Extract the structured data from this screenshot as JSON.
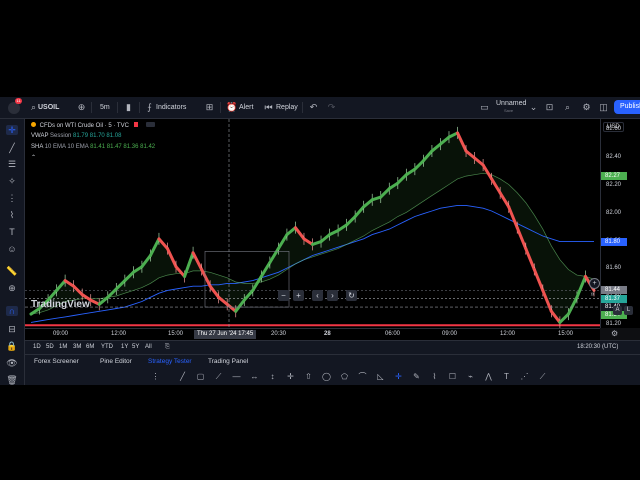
{
  "header": {
    "notification_count": "11",
    "symbol": "USOIL",
    "interval": "5m",
    "indicators_label": "Indicators",
    "alert_label": "Alert",
    "replay_label": "Replay",
    "layout_name": "Unnamed",
    "layout_status": "Save",
    "publish_label": "Publish"
  },
  "legend": {
    "title": "CFDs on WTI Crude Oil · 5 · TVC",
    "vwap_name": "VWAP",
    "vwap_setting": "Session",
    "vwap_values": "81.79  81.70  81.08",
    "sha_name": "SHA",
    "sha_settings": "10  EMA  10  EMA",
    "sha_values": "81.41  81.47  81.36  81.42"
  },
  "watermark": "TradingView",
  "price_axis": {
    "currency": "USD",
    "labels": [
      "82.60",
      "82.40",
      "82.20",
      "82.00",
      "81.80",
      "81.60",
      "81.40",
      "81.20"
    ],
    "badges": [
      {
        "text": "82.27",
        "color": "#4caf50",
        "price": 82.27
      },
      {
        "text": "81.80",
        "color": "#2962ff",
        "price": 81.8
      },
      {
        "text": "81.44",
        "color": "#787b86",
        "price": 81.45
      },
      {
        "text": "81.37",
        "color": "#26a69a",
        "price": 81.39
      },
      {
        "text": "81.40",
        "color": "#131722",
        "price": 81.33
      },
      {
        "text": "81.34",
        "color": "#4caf50",
        "price": 81.27
      }
    ]
  },
  "time_axis": {
    "labels": [
      "09:00",
      "12:00",
      "15:00",
      "20:30",
      "28",
      "06:00",
      "09:00",
      "12:00",
      "15:00"
    ],
    "crosshair_time": "Thu 27 Jun '24   17:45"
  },
  "range_buttons": [
    "1D",
    "5D",
    "1M",
    "3M",
    "6M",
    "YTD",
    "1Y",
    "5Y",
    "All"
  ],
  "clock": "18:20:30 (UTC)",
  "bottom_tabs": [
    "Forex Screener",
    "Pine Editor",
    "Strategy Tester",
    "Trading Panel"
  ],
  "active_bottom_tab": "Strategy Tester",
  "chart_data": {
    "type": "line",
    "title": "CFDs on WTI Crude Oil · 5 · TVC",
    "ylim": [
      81.18,
      82.68
    ],
    "price_series": {
      "name": "USOIL",
      "values": [
        81.28,
        81.32,
        81.38,
        81.45,
        81.52,
        81.48,
        81.42,
        81.38,
        81.35,
        81.4,
        81.46,
        81.52,
        81.58,
        81.62,
        81.7,
        81.82,
        81.75,
        81.62,
        81.55,
        81.72,
        81.6,
        81.48,
        81.4,
        81.35,
        81.3,
        81.38,
        81.45,
        81.55,
        81.65,
        81.75,
        81.85,
        81.9,
        81.82,
        81.78,
        81.8,
        81.85,
        81.88,
        81.92,
        81.98,
        82.05,
        82.1,
        82.12,
        82.18,
        82.22,
        82.28,
        82.32,
        82.38,
        82.45,
        82.5,
        82.55,
        82.58,
        82.45,
        82.4,
        82.35,
        82.25,
        82.15,
        82.05,
        81.9,
        81.75,
        81.6,
        81.45,
        81.3,
        81.22,
        81.28,
        81.4,
        81.55,
        81.45
      ]
    },
    "ema_series": {
      "name": "EMA",
      "values": [
        81.28,
        81.29,
        81.31,
        81.34,
        81.37,
        81.38,
        81.39,
        81.39,
        81.39,
        81.4,
        81.41,
        81.43,
        81.45,
        81.47,
        81.5,
        81.54,
        81.56,
        81.57,
        81.57,
        81.59,
        81.59,
        81.58,
        81.56,
        81.54,
        81.51,
        81.5,
        81.5,
        81.51,
        81.53,
        81.56,
        81.6,
        81.64,
        81.67,
        81.69,
        81.71,
        81.73,
        81.75,
        81.78,
        81.81,
        81.84,
        81.88,
        81.91,
        81.94,
        81.98,
        82.01,
        82.05,
        82.09,
        82.13,
        82.17,
        82.21,
        82.25,
        82.27,
        82.28,
        82.29,
        82.28,
        82.25,
        82.21,
        82.15,
        82.08,
        81.99,
        81.89,
        81.77,
        81.67,
        81.6,
        81.56,
        81.55,
        81.53
      ]
    },
    "vwap_series": {
      "name": "VWAP",
      "values": [
        81.22,
        81.23,
        81.24,
        81.25,
        81.26,
        81.27,
        81.28,
        81.29,
        81.3,
        81.31,
        81.32,
        81.33,
        81.35,
        81.37,
        81.4,
        81.43,
        81.45,
        81.46,
        81.47,
        81.48,
        81.48,
        81.49,
        81.49,
        81.5,
        81.5,
        81.51,
        81.52,
        81.54,
        81.56,
        81.58,
        81.61,
        81.64,
        81.67,
        81.7,
        81.72,
        81.74,
        81.76,
        81.78,
        81.8,
        81.82,
        81.85,
        81.87,
        81.89,
        81.92,
        81.95,
        81.98,
        82.0,
        82.02,
        82.04,
        82.05,
        82.06,
        82.06,
        82.05,
        82.04,
        82.02,
        81.99,
        81.96,
        81.93,
        81.9,
        81.87,
        81.84,
        81.82,
        81.8,
        81.8,
        81.8,
        81.8,
        81.8
      ]
    },
    "horizontal_lines": [
      {
        "price": 81.2,
        "color": "#f23645"
      },
      {
        "price": 81.45,
        "color": "#787b86"
      },
      {
        "price": 81.39,
        "color": "#d1d4dc"
      }
    ]
  }
}
